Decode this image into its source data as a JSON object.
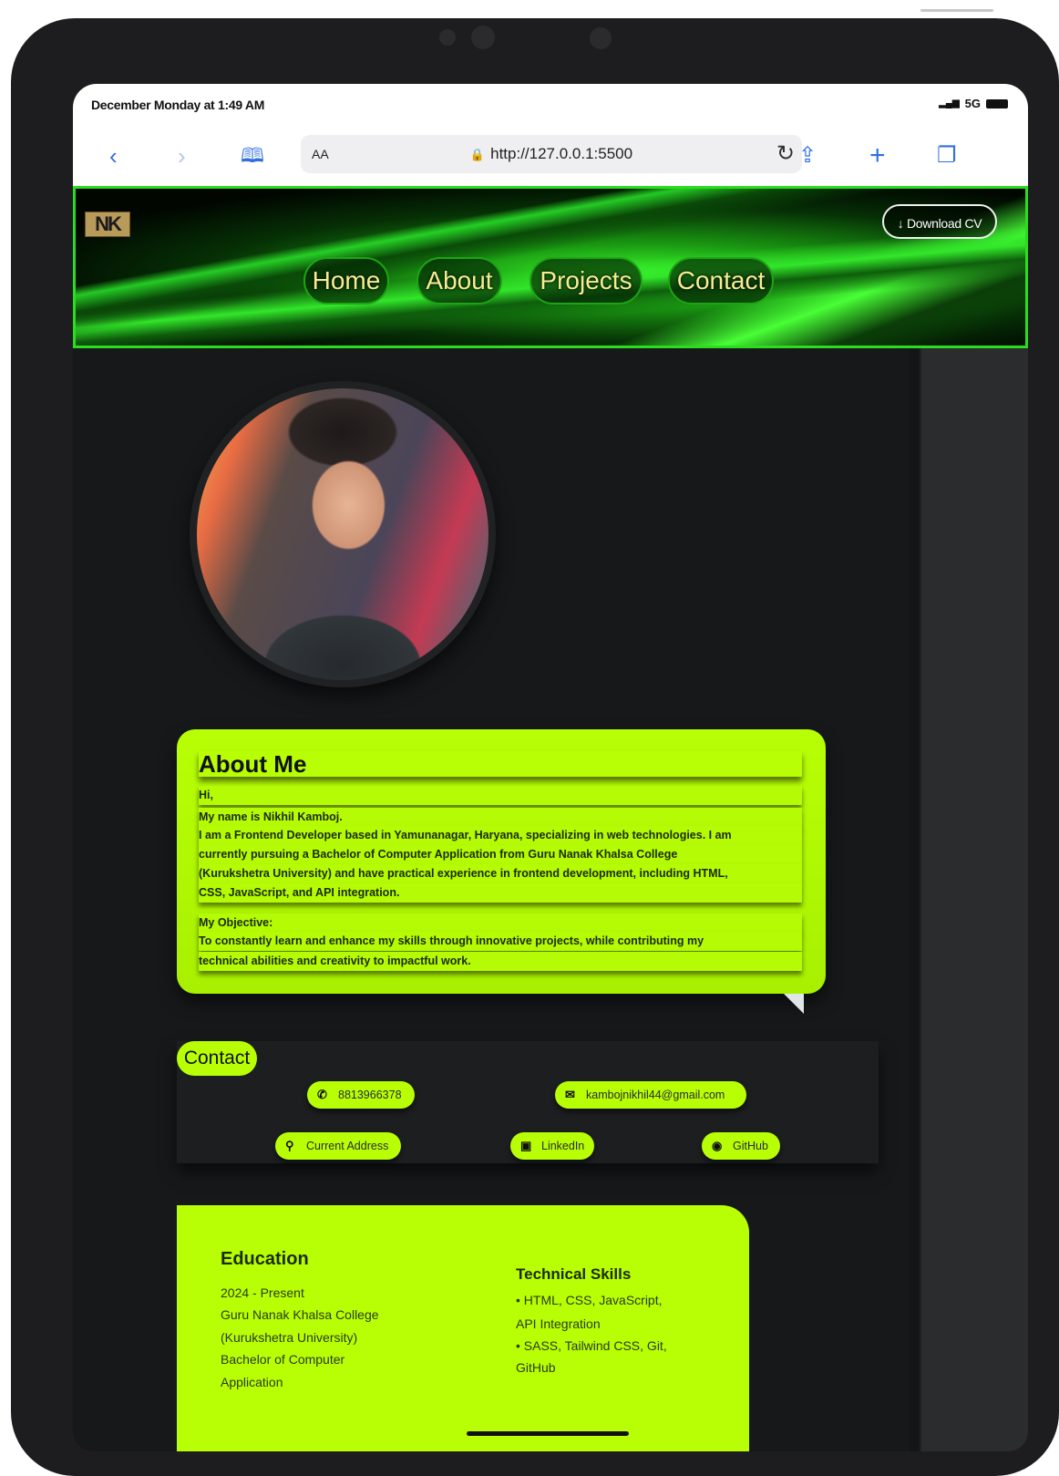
{
  "status_bar": {
    "time": "December Monday at 1:49 AM",
    "signal": "5G"
  },
  "browser": {
    "text_size_label": "AA",
    "url": "http://127.0.0.1:5500"
  },
  "site": {
    "logo": "NK",
    "download_cv": "↓ Download CV",
    "nav": [
      "Home",
      "About",
      "Projects",
      "Contact"
    ]
  },
  "about": {
    "title": "About Me",
    "greeting": "Hi,",
    "name_line": "My name is Nikhil Kamboj.",
    "intro": [
      "I am a Frontend Developer based in Yamunanagar, Haryana, specializing in web technologies. I am",
      "currently pursuing a Bachelor of Computer Application from Guru Nanak Khalsa College",
      "(Kurukshetra University) and have practical experience in frontend development, including HTML,",
      "CSS, JavaScript, and API integration."
    ],
    "objective_label": "My Objective:",
    "objective": [
      "To constantly learn and enhance my skills through innovative projects, while contributing my",
      "technical abilities and creativity to impactful work."
    ]
  },
  "contact": {
    "title": "Contact",
    "phone": "8813966378",
    "email": "kambojnikhil44@gmail.com",
    "address": "Current Address",
    "linkedin": "LinkedIn",
    "github": "GitHub"
  },
  "education": {
    "title": "Education",
    "lines": [
      "2024 - Present",
      "Guru Nanak Khalsa College",
      "(Kurukshetra University)",
      "Bachelor of Computer",
      "Application"
    ]
  },
  "skills": {
    "title": "Technical Skills",
    "lines": [
      "•   HTML, CSS, JavaScript,",
      "API Integration",
      "•   SASS, Tailwind CSS, Git,",
      "GitHub"
    ]
  },
  "colors": {
    "accent": "#b8ff05",
    "hero_green": "#2bdc1f",
    "nav_text": "#f6ed90",
    "background": "#16181a"
  }
}
